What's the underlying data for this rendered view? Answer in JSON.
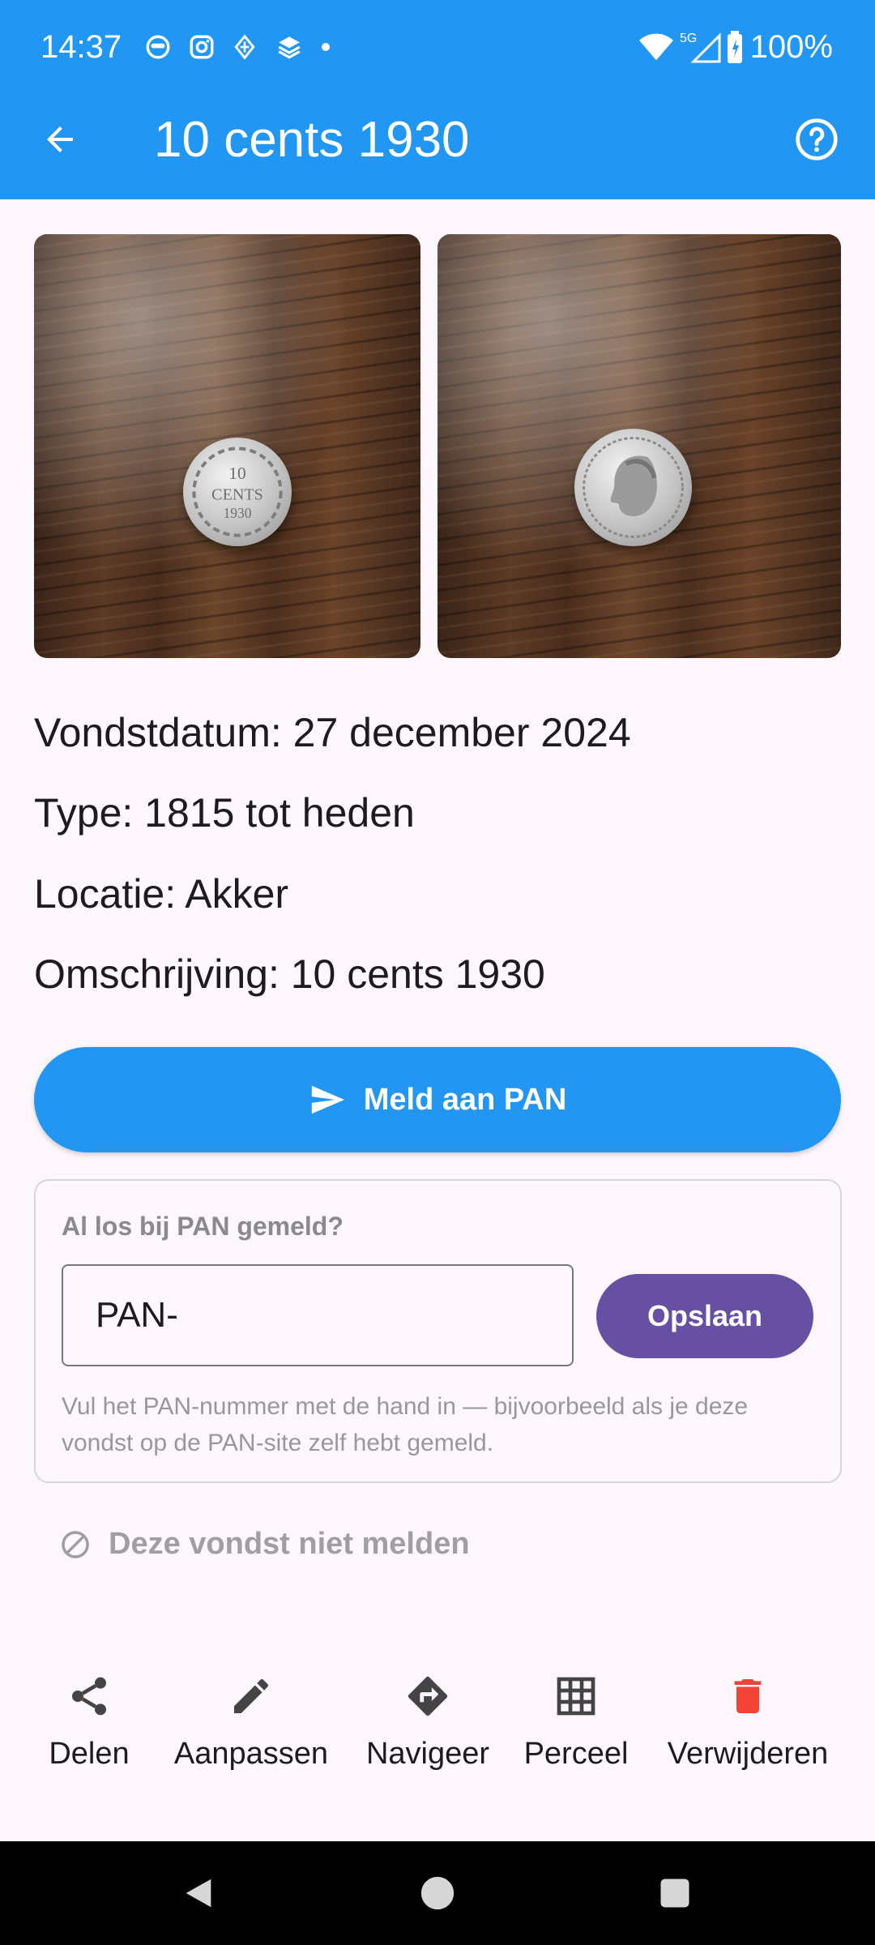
{
  "status_bar": {
    "time": "14:37",
    "network": "5G",
    "battery": "100%",
    "notification_icons": [
      "face-icon",
      "instagram-icon",
      "app-icon",
      "layers-icon",
      "dot-icon"
    ]
  },
  "app_bar": {
    "title": "10 cents 1930",
    "back_icon": "arrow-left-icon",
    "help_icon": "help-circle-icon",
    "color": "#2196f3"
  },
  "photos": {
    "front_coin_text": [
      "10",
      "CENTS",
      "1930"
    ]
  },
  "details": {
    "date": "Vondstdatum: 27 december 2024",
    "type": "Type: 1815 tot heden",
    "location": "Locatie: Akker",
    "description": "Omschrijving: 10 cents 1930"
  },
  "report_button": {
    "label": "Meld aan PAN",
    "icon": "send-icon"
  },
  "manual_card": {
    "title": "Al los bij PAN gemeld?",
    "input_value": "PAN-",
    "save_label": "Opslaan",
    "helper_text": "Vul het PAN-nummer met de hand in — bijvoorbeeld als je deze vondst op de PAN-site zelf hebt gemeld.",
    "save_color": "#6750a4"
  },
  "skip": {
    "label": "Deze vondst niet melden",
    "icon": "block-icon"
  },
  "actions": [
    {
      "label": "Delen",
      "icon": "share-icon"
    },
    {
      "label": "Aanpassen",
      "icon": "edit-icon"
    },
    {
      "label": "Navigeer",
      "icon": "directions-icon"
    },
    {
      "label": "Perceel",
      "icon": "grid-icon"
    },
    {
      "label": "Verwijderen",
      "icon": "delete-icon",
      "color": "#f44336"
    }
  ],
  "nav_bar": [
    "back",
    "home",
    "recents"
  ]
}
